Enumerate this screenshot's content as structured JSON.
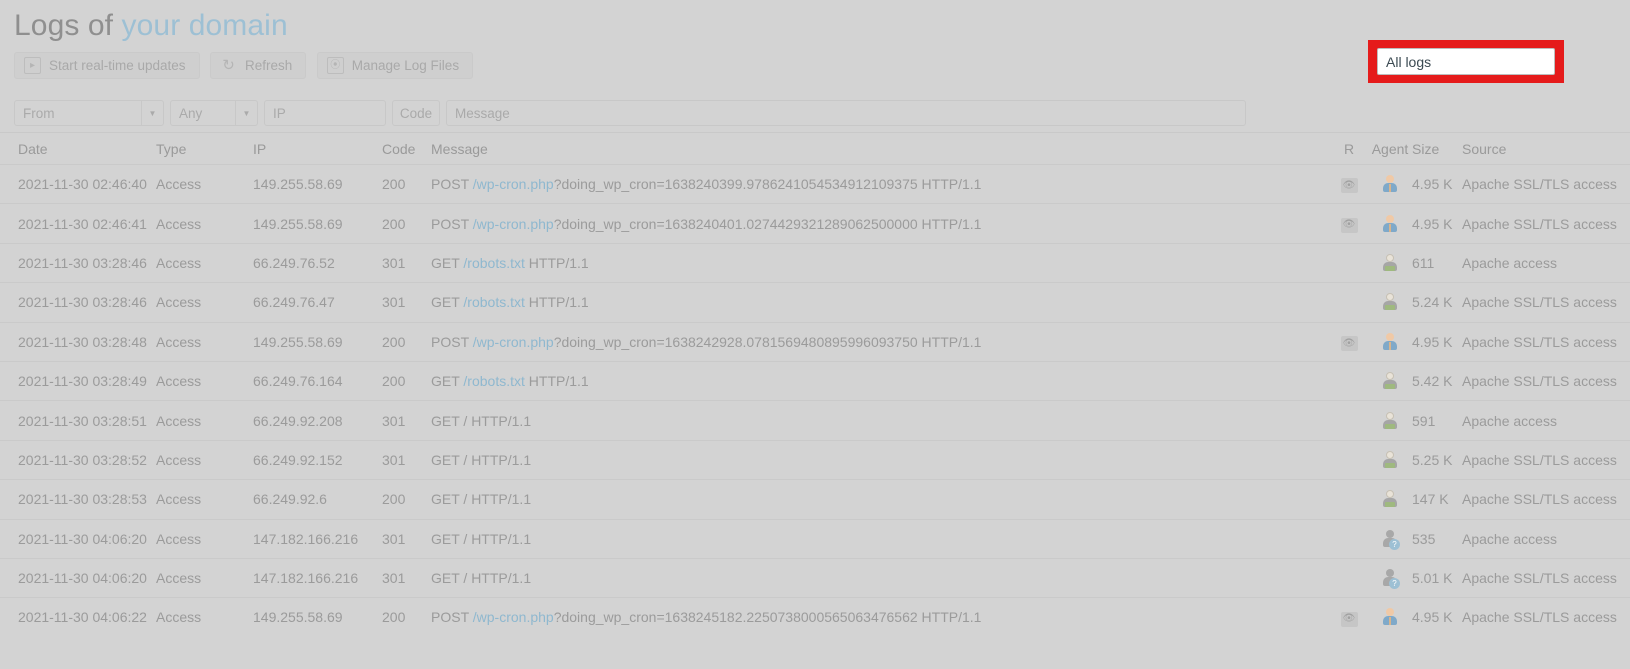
{
  "page": {
    "title_prefix": "Logs of ",
    "title_domain": "your domain"
  },
  "toolbar": {
    "buttons": [
      {
        "label": "Start real-time updates",
        "icon": "play-icon",
        "glyph": "▸"
      },
      {
        "label": "Refresh",
        "icon": "refresh-icon",
        "glyph": "↻"
      },
      {
        "label": "Manage Log Files",
        "icon": "manage-files-icon",
        "glyph": "⦿"
      }
    ],
    "log_select": {
      "value": "All logs",
      "highlighted": true,
      "highlight_color": "#e51b1b"
    }
  },
  "filters": [
    {
      "name": "date-from",
      "placeholder": "From",
      "value": "",
      "type": "combo"
    },
    {
      "name": "type",
      "placeholder": "Any",
      "value": "",
      "type": "combo"
    },
    {
      "name": "ip",
      "placeholder": "IP",
      "value": "",
      "type": "text"
    },
    {
      "name": "code",
      "placeholder": "Code",
      "value": "",
      "type": "text"
    },
    {
      "name": "message",
      "placeholder": "Message",
      "value": "",
      "type": "text"
    }
  ],
  "table": {
    "columns": [
      "Date",
      "Type",
      "IP",
      "Code",
      "Message",
      "R",
      "Agent",
      "Size",
      "Source"
    ],
    "rows": [
      {
        "date": "2021-11-30 02:46:40",
        "type": "Access",
        "ip": "149.255.58.69",
        "code": "200",
        "msg_method": "POST ",
        "msg_link": "/wp-cron.php",
        "msg_rest": "?doing_wp_cron=1638240399.9786241054534912109375 HTTP/1.1",
        "r": true,
        "agent": "human",
        "size": "4.95 K",
        "source": "Apache SSL/TLS access"
      },
      {
        "date": "2021-11-30 02:46:41",
        "type": "Access",
        "ip": "149.255.58.69",
        "code": "200",
        "msg_method": "POST ",
        "msg_link": "/wp-cron.php",
        "msg_rest": "?doing_wp_cron=1638240401.0274429321289062500000 HTTP/1.1",
        "r": true,
        "agent": "human",
        "size": "4.95 K",
        "source": "Apache SSL/TLS access"
      },
      {
        "date": "2021-11-30 03:28:46",
        "type": "Access",
        "ip": "66.249.76.52",
        "code": "301",
        "msg_method": "GET ",
        "msg_link": "/robots.txt",
        "msg_rest": " HTTP/1.1",
        "r": false,
        "agent": "bot",
        "size": "611",
        "source": "Apache access"
      },
      {
        "date": "2021-11-30 03:28:46",
        "type": "Access",
        "ip": "66.249.76.47",
        "code": "301",
        "msg_method": "GET ",
        "msg_link": "/robots.txt",
        "msg_rest": " HTTP/1.1",
        "r": false,
        "agent": "bot",
        "size": "5.24 K",
        "source": "Apache SSL/TLS access"
      },
      {
        "date": "2021-11-30 03:28:48",
        "type": "Access",
        "ip": "149.255.58.69",
        "code": "200",
        "msg_method": "POST ",
        "msg_link": "/wp-cron.php",
        "msg_rest": "?doing_wp_cron=1638242928.0781569480895996093750 HTTP/1.1",
        "r": true,
        "agent": "human",
        "size": "4.95 K",
        "source": "Apache SSL/TLS access"
      },
      {
        "date": "2021-11-30 03:28:49",
        "type": "Access",
        "ip": "66.249.76.164",
        "code": "200",
        "msg_method": "GET ",
        "msg_link": "/robots.txt",
        "msg_rest": " HTTP/1.1",
        "r": false,
        "agent": "bot",
        "size": "5.42 K",
        "source": "Apache SSL/TLS access"
      },
      {
        "date": "2021-11-30 03:28:51",
        "type": "Access",
        "ip": "66.249.92.208",
        "code": "301",
        "msg_method": "GET / HTTP/1.1",
        "msg_link": "",
        "msg_rest": "",
        "r": false,
        "agent": "bot",
        "size": "591",
        "source": "Apache access"
      },
      {
        "date": "2021-11-30 03:28:52",
        "type": "Access",
        "ip": "66.249.92.152",
        "code": "301",
        "msg_method": "GET / HTTP/1.1",
        "msg_link": "",
        "msg_rest": "",
        "r": false,
        "agent": "bot",
        "size": "5.25 K",
        "source": "Apache SSL/TLS access"
      },
      {
        "date": "2021-11-30 03:28:53",
        "type": "Access",
        "ip": "66.249.92.6",
        "code": "200",
        "msg_method": "GET / HTTP/1.1",
        "msg_link": "",
        "msg_rest": "",
        "r": false,
        "agent": "bot",
        "size": "147 K",
        "source": "Apache SSL/TLS access"
      },
      {
        "date": "2021-11-30 04:06:20",
        "type": "Access",
        "ip": "147.182.166.216",
        "code": "301",
        "msg_method": "GET / HTTP/1.1",
        "msg_link": "",
        "msg_rest": "",
        "r": false,
        "agent": "unknown",
        "size": "535",
        "source": "Apache access"
      },
      {
        "date": "2021-11-30 04:06:20",
        "type": "Access",
        "ip": "147.182.166.216",
        "code": "301",
        "msg_method": "GET / HTTP/1.1",
        "msg_link": "",
        "msg_rest": "",
        "r": false,
        "agent": "unknown",
        "size": "5.01 K",
        "source": "Apache SSL/TLS access"
      },
      {
        "date": "2021-11-30 04:06:22",
        "type": "Access",
        "ip": "149.255.58.69",
        "code": "200",
        "msg_method": "POST ",
        "msg_link": "/wp-cron.php",
        "msg_rest": "?doing_wp_cron=1638245182.2250738000565063476562 HTTP/1.1",
        "r": true,
        "agent": "human",
        "size": "4.95 K",
        "source": "Apache SSL/TLS access"
      }
    ]
  }
}
